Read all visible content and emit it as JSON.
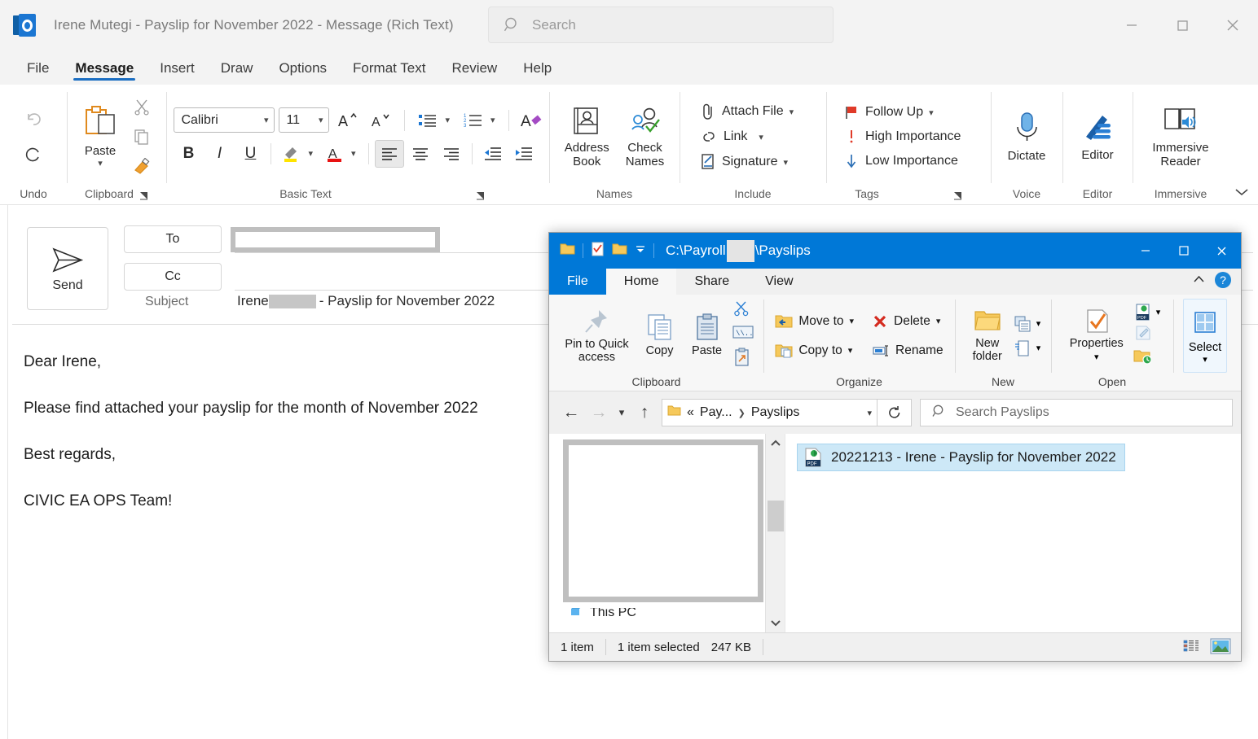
{
  "outlook": {
    "title": "Irene Mutegi - Payslip for November 2022  -  Message (Rich Text)",
    "search_placeholder": "Search",
    "window_controls": {
      "minimize": "—",
      "maximize": "□",
      "close": "✕"
    },
    "tabs": [
      {
        "label": "File"
      },
      {
        "label": "Message"
      },
      {
        "label": "Insert"
      },
      {
        "label": "Draw"
      },
      {
        "label": "Options"
      },
      {
        "label": "Format Text"
      },
      {
        "label": "Review"
      },
      {
        "label": "Help"
      }
    ],
    "ribbon": {
      "groups": {
        "undo": {
          "label": "Undo",
          "undo": "Undo",
          "redo": "Redo"
        },
        "clipboard": {
          "label": "Clipboard",
          "paste": "Paste",
          "cut": "Cut",
          "copy": "Copy",
          "format_painter": "Format Painter"
        },
        "basic_text": {
          "label": "Basic Text",
          "font_name": "Calibri",
          "font_size": "11",
          "grow_font": "Grow Font",
          "shrink_font": "Shrink Font",
          "bullets": "Bullets",
          "numbering": "Numbering",
          "clear_formatting": "Clear All Formatting",
          "bold": "B",
          "italic": "I",
          "underline": "U",
          "highlight": "Text Highlight Color",
          "font_color": "Font Color",
          "align_left": "Align Left",
          "align_center": "Center",
          "align_right": "Align Right",
          "decrease_indent": "Decrease Indent",
          "increase_indent": "Increase Indent"
        },
        "names": {
          "label": "Names",
          "address_book": "Address\nBook",
          "address_book_l1": "Address",
          "address_book_l2": "Book",
          "check_names_l1": "Check",
          "check_names_l2": "Names"
        },
        "include": {
          "label": "Include",
          "attach_file": "Attach File",
          "link": "Link",
          "signature": "Signature"
        },
        "tags": {
          "label": "Tags",
          "follow_up": "Follow Up",
          "high_importance": "High Importance",
          "low_importance": "Low Importance"
        },
        "voice": {
          "label": "Voice",
          "dictate": "Dictate"
        },
        "editor": {
          "label": "Editor",
          "editor": "Editor"
        },
        "immersive": {
          "label": "Immersive",
          "reader_l1": "Immersive",
          "reader_l2": "Reader"
        }
      }
    },
    "compose": {
      "send": "Send",
      "to_label": "To",
      "cc_label": "Cc",
      "subject_label": "Subject",
      "subject_value_prefix": "Irene",
      "subject_value_suffix": "- Payslip for November 2022",
      "body_lines": [
        "Dear Irene,",
        "Please find attached your payslip for the month of November 2022",
        "Best regards,",
        "CIVIC EA OPS Team!"
      ]
    }
  },
  "explorer": {
    "title_prefix": "C:\\Payroll",
    "title_suffix": "\\Payslips",
    "quick_access": {
      "folder": "folder-icon",
      "checklist": "properties-icon",
      "newfolder": "new-folder-icon",
      "more": "customize-quick-access-icon"
    },
    "window_controls": {
      "minimize": "—",
      "maximize": "□",
      "close": "✕"
    },
    "tabs": [
      {
        "label": "File"
      },
      {
        "label": "Home"
      },
      {
        "label": "Share"
      },
      {
        "label": "View"
      }
    ],
    "help": "?",
    "ribbon": {
      "clipboard": {
        "label": "Clipboard",
        "pin_l1": "Pin to Quick",
        "pin_l2": "access",
        "copy": "Copy",
        "paste": "Paste",
        "cut": "Cut",
        "copy_path": "Copy path",
        "paste_shortcut": "Paste shortcut"
      },
      "organize": {
        "label": "Organize",
        "move_to": "Move to",
        "copy_to": "Copy to",
        "delete": "Delete",
        "rename": "Rename"
      },
      "new": {
        "label": "New",
        "new_folder_l1": "New",
        "new_folder_l2": "folder",
        "new_item": "New item",
        "easy_access": "Easy access"
      },
      "open": {
        "label": "Open",
        "properties": "Properties",
        "open_with": "Open",
        "edit": "Edit",
        "history": "History"
      },
      "select": {
        "label": "Select",
        "select": "Select"
      }
    },
    "nav": {
      "back": "Back",
      "forward": "Forward",
      "recent": "Recent locations",
      "up": "Up",
      "breadcrumb_sep": "«",
      "breadcrumb_parent": "Pay...",
      "breadcrumb_current": "Payslips",
      "refresh": "Refresh",
      "search_placeholder": "Search Payslips"
    },
    "nav_pane": {
      "this_pc": "This PC"
    },
    "files": [
      {
        "name": "20221213 - Irene - Payslip for November 2022",
        "type": "pdf",
        "selected": true
      }
    ],
    "status": {
      "item_count": "1 item",
      "selection": "1 item selected",
      "size": "247 KB",
      "view_details": "details-view-icon",
      "view_thumbnails": "large-icons-view-icon"
    }
  }
}
